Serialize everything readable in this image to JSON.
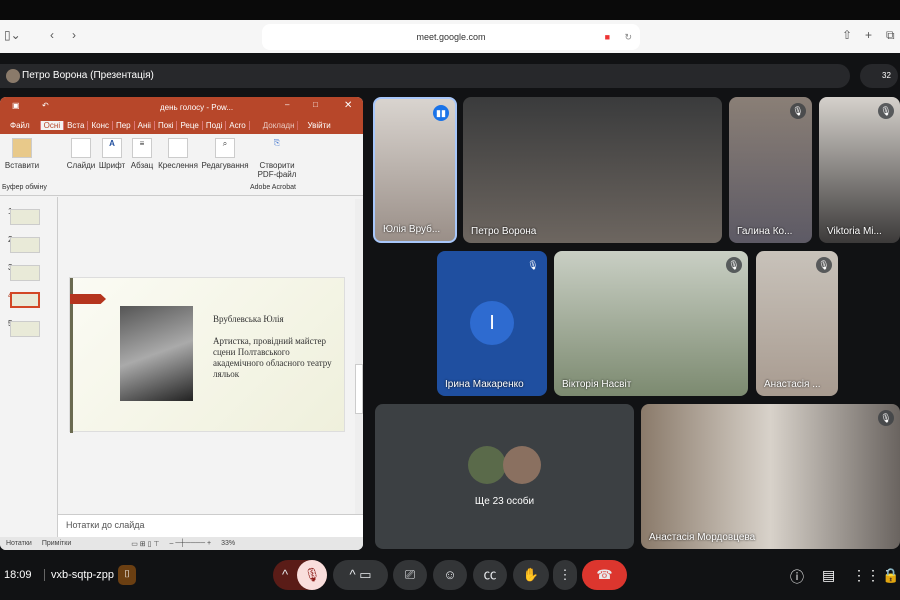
{
  "browser": {
    "url": "meet.google.com"
  },
  "presentation_bar": {
    "label": "Петро Ворона (Презентація)",
    "participants_count": "32"
  },
  "ppt": {
    "title": "день голосу - Pow...",
    "tabs": [
      "Файл",
      "Осні",
      "Вста",
      "Конс",
      "Пер",
      "Аніі",
      "Покі",
      "Реце",
      "Поді",
      "Acro",
      "Докладн",
      "Увійти"
    ],
    "ribbon": {
      "paste": "Вставити",
      "clipboard": "Буфер обміну",
      "slides": "Слайди",
      "font": "Шрифт",
      "paragraph": "Абзац",
      "drawing": "Креслення",
      "editing": "Редагування",
      "create_pdf": "Створити PDF-файл",
      "acrobat": "Adobe Acrobat"
    },
    "thumbs": [
      "1",
      "2",
      "3",
      "4",
      "5"
    ],
    "slide": {
      "name": "Врублевська Юлія",
      "desc": "Артистка, провідний майстер сцени Полтавського академічного обласного театру ляльок"
    },
    "notes_placeholder": "Нотатки до слайда",
    "status": {
      "notes": "Нотатки",
      "comments": "Примітки",
      "zoom": "33%"
    }
  },
  "tiles": [
    {
      "name": "Юлія Вруб..."
    },
    {
      "name": "Петро Ворона"
    },
    {
      "name": "Галина Ко..."
    },
    {
      "name": "Viktoria Mi..."
    },
    {
      "name": "Ірина Макаренко",
      "initial": "І"
    },
    {
      "name": "Вікторія Насвіт"
    },
    {
      "name": "Анастасія ..."
    },
    {
      "name": "Ще 23 особи"
    },
    {
      "name": "Анастасія Мордовцева"
    }
  ],
  "bottom": {
    "time": "18:09",
    "meeting_code": "vxb-sqtp-zpp"
  }
}
